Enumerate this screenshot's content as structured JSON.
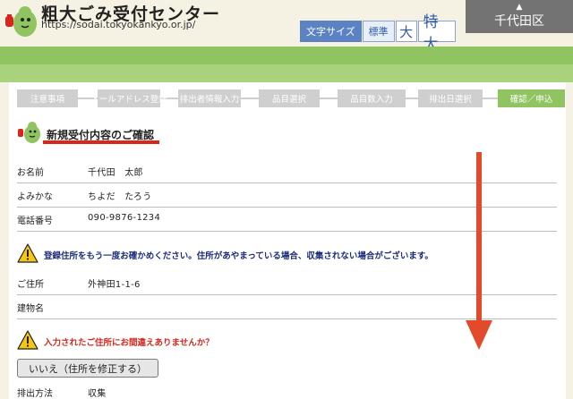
{
  "header": {
    "site_title": "粗大ごみ受付センター",
    "site_url": "https://sodai.tokyokankyo.or.jp/",
    "font_size_label": "文字サイズ",
    "font_size_standard": "標準",
    "font_size_large": "大",
    "font_size_xlarge": "特大",
    "ward_arrow": "▲",
    "ward_name": "千代田区"
  },
  "steps": [
    {
      "label": "注意事項"
    },
    {
      "label": "メールアドレス登録"
    },
    {
      "label": "排出者情報入力"
    },
    {
      "label": "品目選択"
    },
    {
      "label": "品目数入力"
    },
    {
      "label": "排出日選択"
    },
    {
      "label": "確認／申込"
    }
  ],
  "section": {
    "title": "新規受付内容のご確認"
  },
  "rows": {
    "name": {
      "label": "お名前",
      "value": "千代田　太郎"
    },
    "kana": {
      "label": "よみかな",
      "value": "ちよだ　たろう"
    },
    "phone": {
      "label": "電話番号",
      "value": "090-9876-1234"
    },
    "address": {
      "label": "ご住所",
      "value": "外神田1-1-6"
    },
    "building": {
      "label": "建物名",
      "value": ""
    },
    "method": {
      "label": "排出方法",
      "value": "収集"
    }
  },
  "warnings": {
    "address_check": "登録住所をもう一度お確かめください。住所があやまっている場合、収集されない場合がございます。",
    "address_confirm": "入力されたご住所にお間違えありませんか？"
  },
  "buttons": {
    "fix_address": "いいえ（住所を修正する）"
  },
  "colors": {
    "accent_green": "#8fc460",
    "underline_red": "#d9261c",
    "warning_blue": "#1b2c7a",
    "arrow_red": "#e34a2b"
  }
}
